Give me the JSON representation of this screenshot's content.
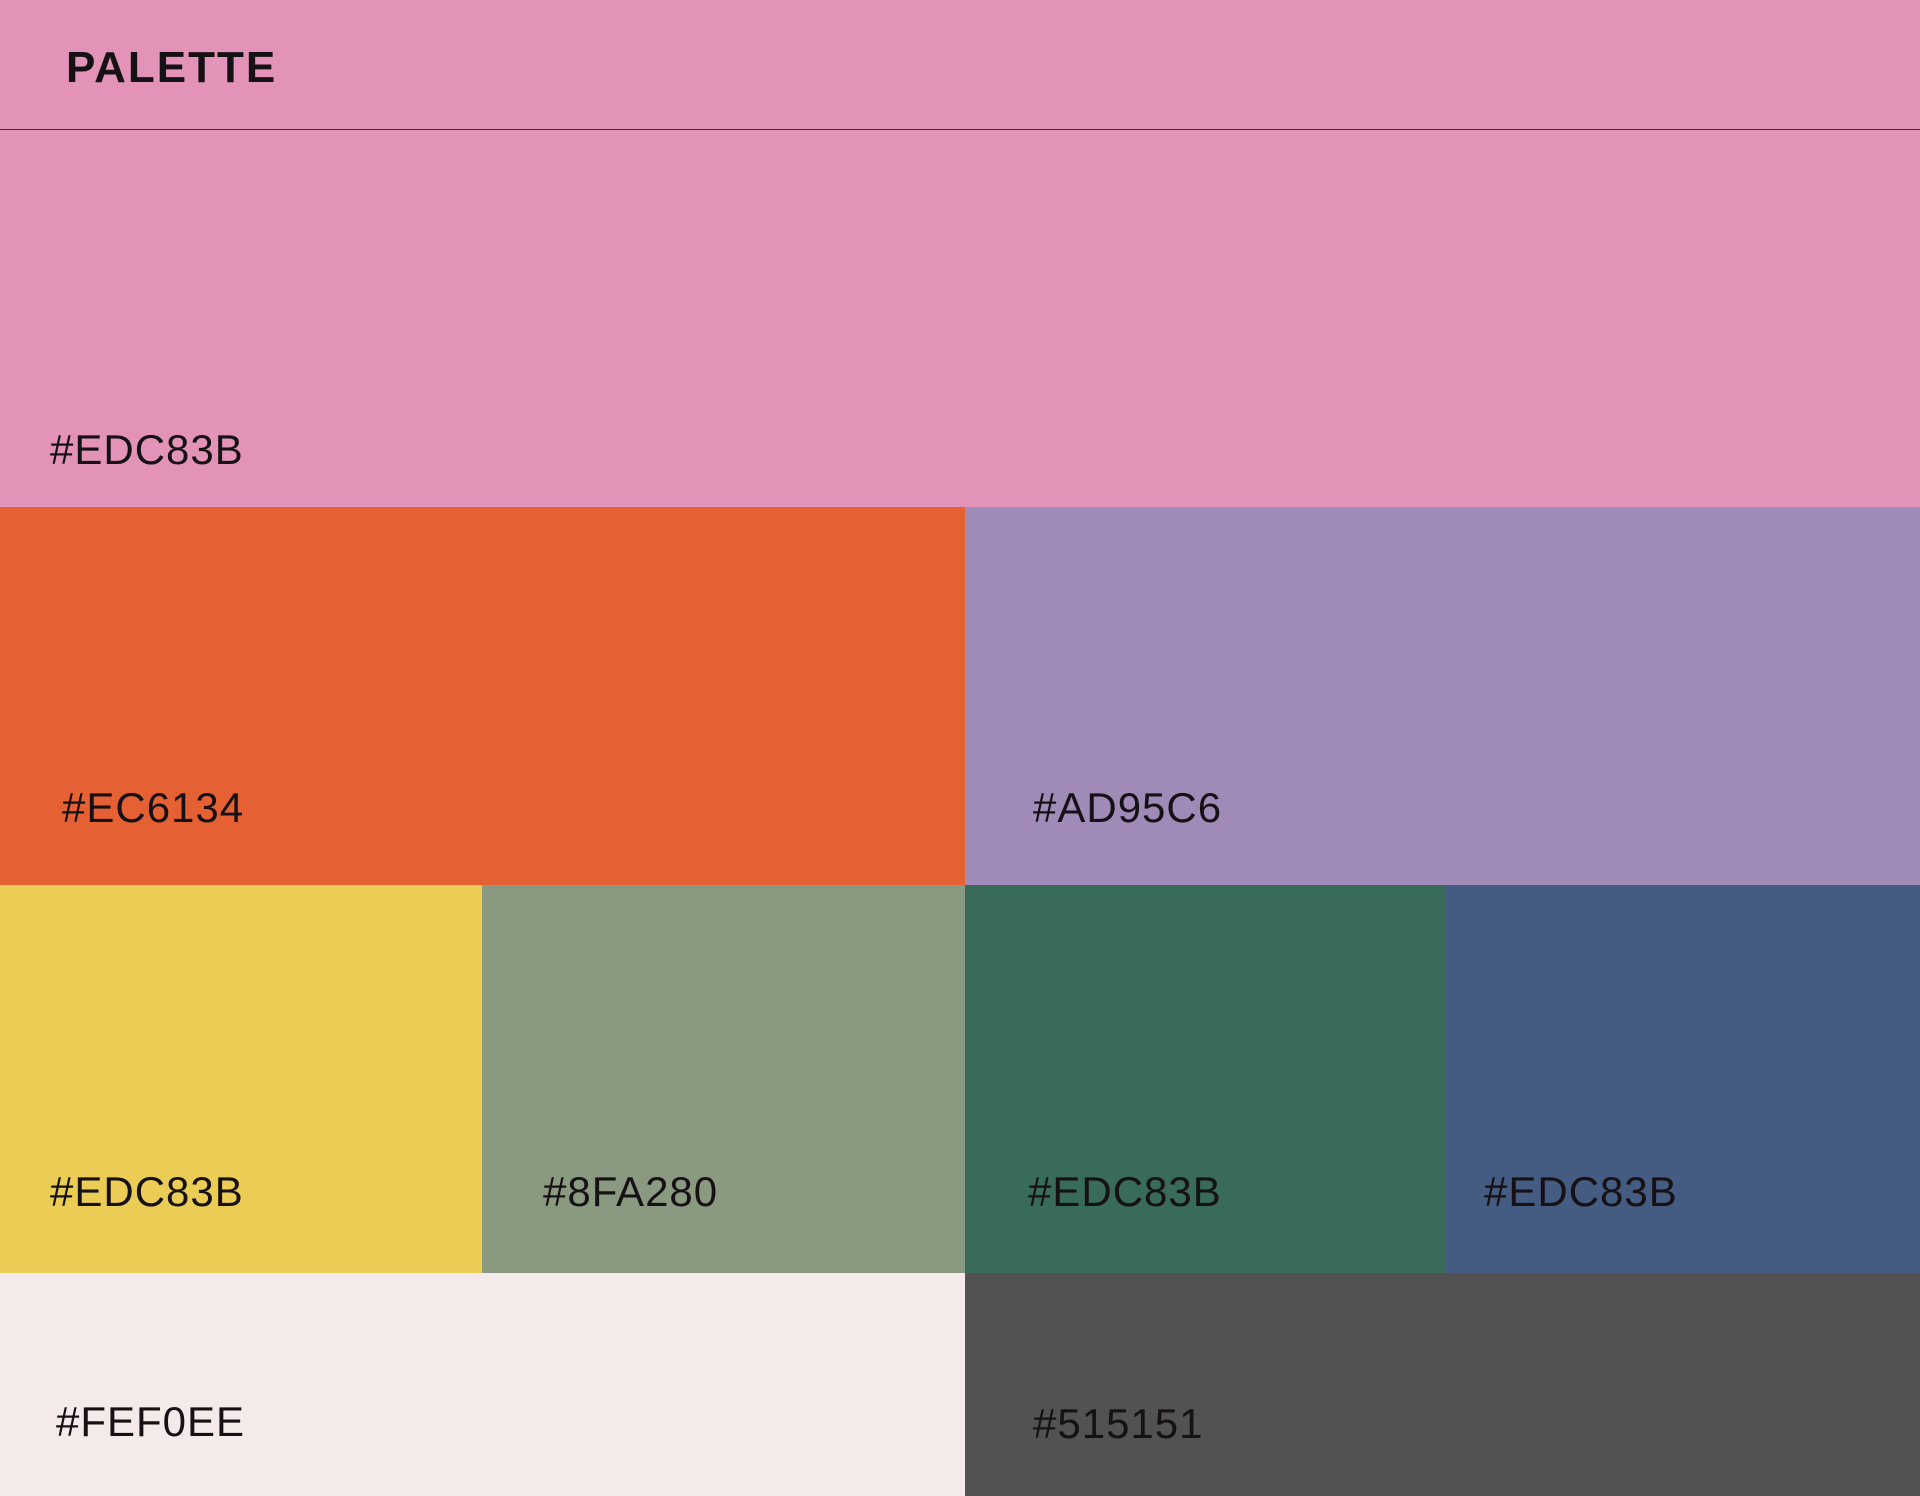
{
  "header": {
    "title": "PALETTE"
  },
  "palette": {
    "rows": [
      {
        "swatches": [
          {
            "label": "#EDC83B",
            "fill": "#E393B8"
          }
        ]
      },
      {
        "swatches": [
          {
            "label": "#EC6134",
            "fill": "#E56134"
          },
          {
            "label": "#AD95C6",
            "fill": "#A08AB8"
          }
        ]
      },
      {
        "swatches": [
          {
            "label": "#EDC83B",
            "fill": "#EBCD55"
          },
          {
            "label": "#8FA280",
            "fill": "#8A9A80"
          },
          {
            "label": "#EDC83B",
            "fill": "#386B59"
          },
          {
            "label": "#EDC83B",
            "fill": "#445C81"
          }
        ]
      },
      {
        "swatches": [
          {
            "label": "#FEF0EE",
            "fill": "#F5EAEA"
          },
          {
            "label": "#515151",
            "fill": "#525252"
          }
        ]
      }
    ]
  }
}
